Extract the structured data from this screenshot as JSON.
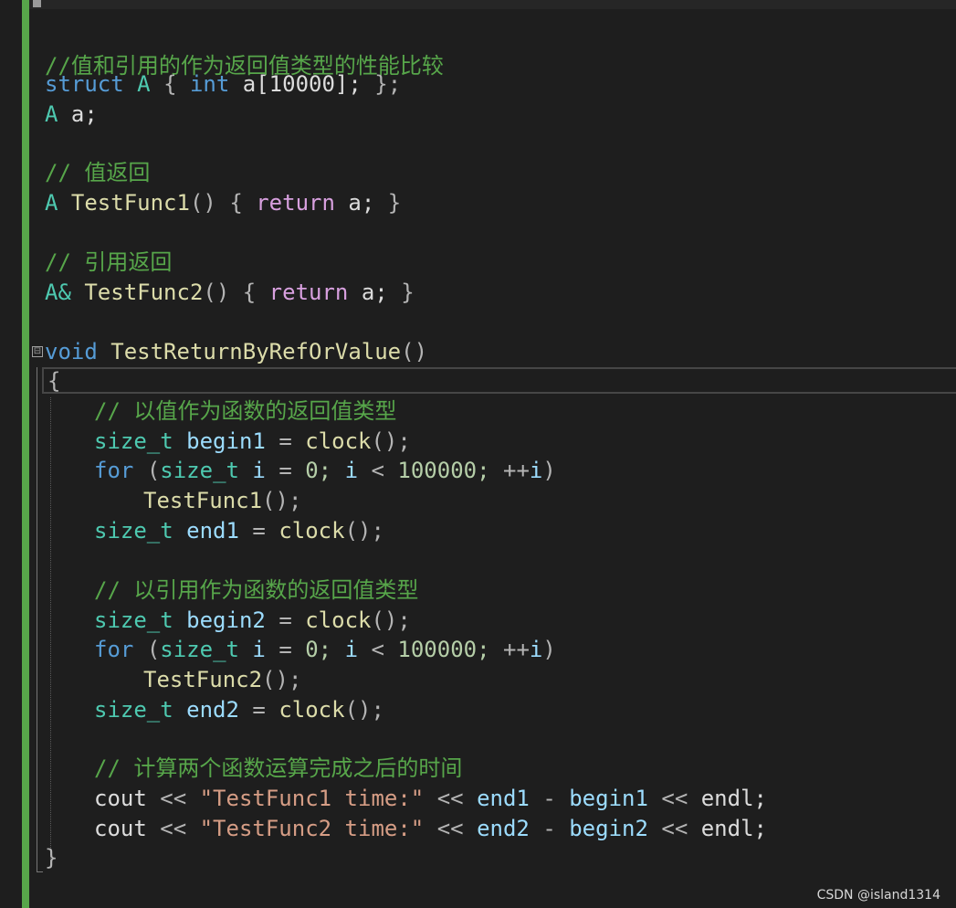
{
  "code": {
    "line_top": "//}",
    "comment_compare": "//值和引用的作为返回值类型的性能比较",
    "kw_struct": "struct",
    "struct_name": "A",
    "brace_open": "{",
    "kw_int": "int",
    "array_decl": "a[10000];",
    "brace_close_semi": "};",
    "type_A": "A",
    "var_a_decl": "a;",
    "comment_value_return": "// 值返回",
    "func1_name": "TestFunc1",
    "func2_name": "TestFunc2",
    "parens": "()",
    "kw_return": "return",
    "ret_a": "a;",
    "brace_close": "}",
    "comment_ref_return": "// 引用返回",
    "type_A_ref": "A&",
    "kw_void": "void",
    "main_func_name": "TestReturnByRefOrValue",
    "comment_by_value": "// 以值作为函数的返回值类型",
    "type_size_t": "size_t",
    "var_begin1": "begin1",
    "var_end1": "end1",
    "var_begin2": "begin2",
    "var_end2": "end2",
    "eq": "=",
    "clock_fn": "clock",
    "call_semi": "();",
    "kw_for": "for",
    "paren_open": "(",
    "var_i": "i",
    "zero_semi": "0;",
    "lt": "<",
    "limit": "100000;",
    "inc": "++",
    "paren_close": ")",
    "comment_by_ref": "// 以引用作为函数的返回值类型",
    "comment_compute": "// 计算两个函数运算完成之后的时间",
    "cout": "cout",
    "shl": "<<",
    "str1": "\"TestFunc1 time:\"",
    "str2": "\"TestFunc2 time:\"",
    "minus": "-",
    "endl": "endl;",
    "fold_glyph": "⊟"
  },
  "watermark": "CSDN @island1314",
  "colors": {
    "background": "#1e1e1e",
    "keyword": "#569cd6",
    "type": "#4ec9b0",
    "function": "#dcdcaa",
    "control_keyword": "#d8a0df",
    "comment": "#57a64a",
    "string": "#d69d85",
    "variable": "#9cdcfe",
    "number": "#b5cea8",
    "change_bar": "#57a64a"
  }
}
